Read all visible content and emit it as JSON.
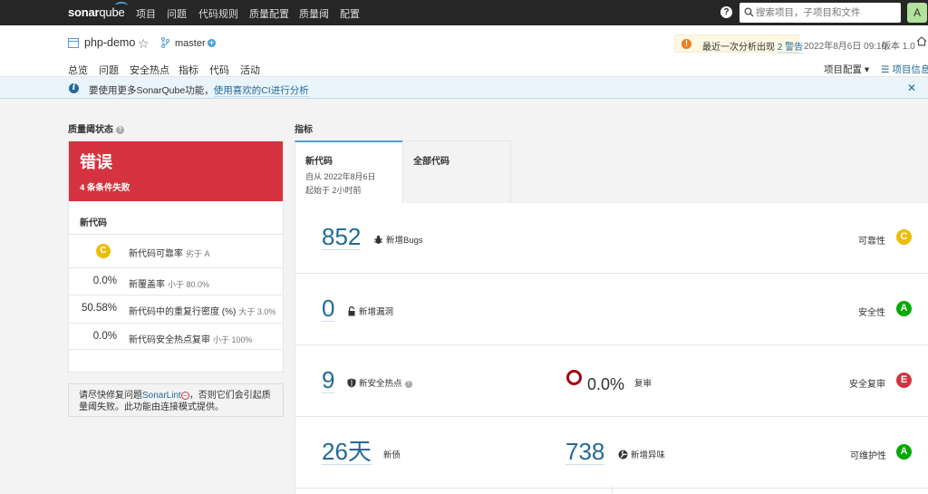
{
  "topnav": {
    "logo_sonar": "sonar",
    "logo_qube": "qube",
    "items": [
      "项目",
      "问题",
      "代码规则",
      "质量配置",
      "质量阈",
      "配置"
    ],
    "search_placeholder": "搜索项目，子项目和文件",
    "avatar_letter": "A"
  },
  "project": {
    "name": "php-demo",
    "branch": "master",
    "warning_text": "最近一次分析出现",
    "warning_link": "2 警告",
    "analysis_date": "2022年8月6日 09:10",
    "version": "版本 1.0",
    "tabs": [
      "总览",
      "问题",
      "安全热点",
      "指标",
      "代码",
      "活动"
    ],
    "settings_label": "项目配置",
    "info_label": "项目信息"
  },
  "banner": {
    "text": "要使用更多SonarQube功能，",
    "link": "使用喜欢的CI进行分析"
  },
  "quality_gate": {
    "title": "质量阈状态",
    "status": "错误",
    "failed": "4 条条件失败",
    "section": "新代码",
    "conditions": [
      {
        "value": "",
        "rating": "C",
        "metric": "新代码可靠率",
        "condition": "劣于 A"
      },
      {
        "value": "0.0%",
        "rating": "",
        "metric": "新覆盖率",
        "condition": "小于 80.0%"
      },
      {
        "value": "50.58%",
        "rating": "",
        "metric": "新代码中的重复行密度 (%)",
        "condition": "大于 3.0%"
      },
      {
        "value": "0.0%",
        "rating": "",
        "metric": "新代码安全热点复审",
        "condition": "小于 100%"
      }
    ],
    "sonarlint_text_1": "请尽快修复问题",
    "sonarlint_link": "SonarLint",
    "sonarlint_text_2": "，否则它们会引起质量阈失败。此功能由连接模式提供。"
  },
  "measures": {
    "title": "指标",
    "tab_new": "新代码",
    "tab_new_since": "自从 2022年8月6日",
    "tab_new_started": "起始于 2小时前",
    "tab_all": "全部代码",
    "rows": [
      {
        "value": "852",
        "label": "新增Bugs",
        "category": "可靠性",
        "grade": "C",
        "grade_color": "#eabe06"
      },
      {
        "value": "0",
        "label": "新增漏洞",
        "category": "安全性",
        "grade": "A",
        "grade_color": "#00aa00"
      },
      {
        "value": "9",
        "label": "新安全热点",
        "value2": "0.0%",
        "label2": "复审",
        "category": "安全复审",
        "grade": "E",
        "grade_color": "#d4333f"
      },
      {
        "value": "26天",
        "label": "新债",
        "value2": "738",
        "label2": "新增异味",
        "category": "可维护性",
        "grade": "A",
        "grade_color": "#00aa00"
      }
    ]
  }
}
